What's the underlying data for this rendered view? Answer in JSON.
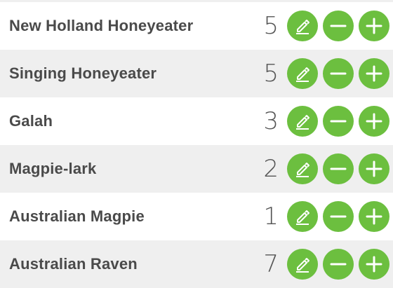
{
  "birds": [
    {
      "name": "New Holland Honeyeater",
      "count": "5"
    },
    {
      "name": "Singing Honeyeater",
      "count": "5"
    },
    {
      "name": "Galah",
      "count": "3"
    },
    {
      "name": "Magpie-lark",
      "count": "2"
    },
    {
      "name": "Australian Magpie",
      "count": "1"
    },
    {
      "name": "Australian Raven",
      "count": "7"
    }
  ],
  "icons": {
    "edit": "pencil-icon",
    "decrement": "minus-icon",
    "increment": "plus-icon"
  },
  "colors": {
    "accent": "#6cbf3f",
    "row_alt": "#efefef",
    "text": "#4a4a4a"
  }
}
